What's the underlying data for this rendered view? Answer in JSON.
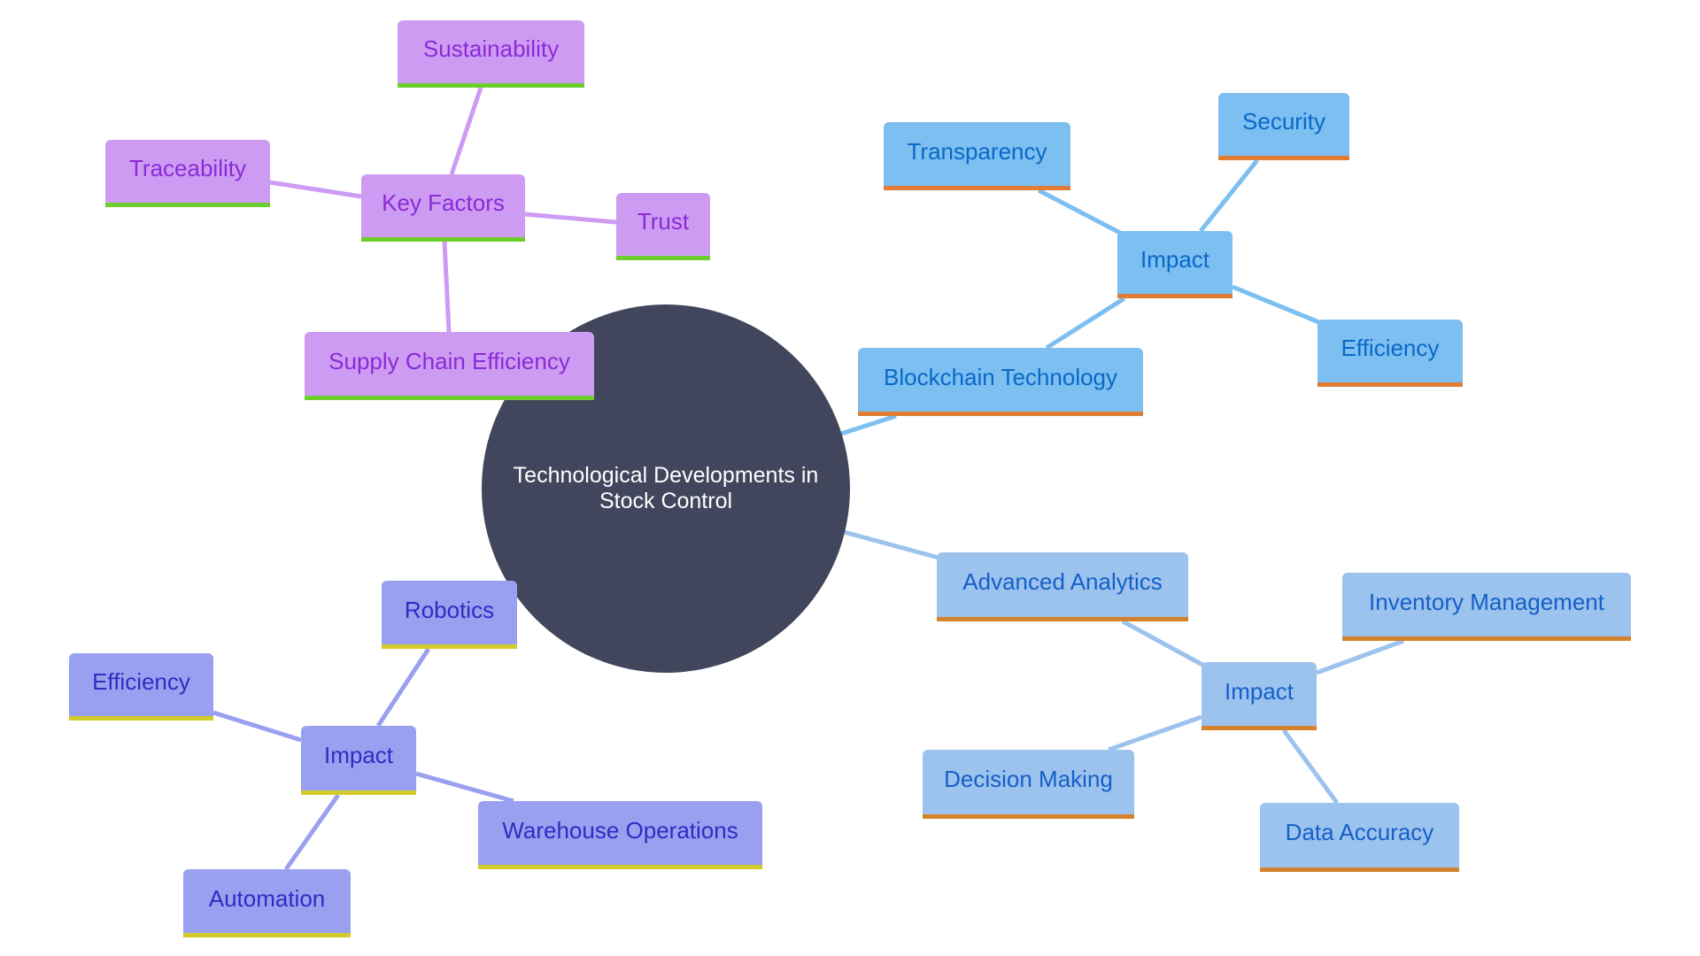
{
  "root": {
    "label": "Technological Developments in Stock Control",
    "color": "#41465c"
  },
  "branches": [
    {
      "name": "supply-chain",
      "color": "#cd9cf2",
      "accent": "#6ccd2c",
      "nodes": {
        "main": "Supply Chain Efficiency",
        "hub": "Key Factors",
        "leaves": [
          "Sustainability",
          "Traceability",
          "Trust"
        ]
      }
    },
    {
      "name": "blockchain",
      "color": "#7cbff0",
      "accent": "#e07c33",
      "nodes": {
        "main": "Blockchain Technology",
        "hub": "Impact",
        "leaves": [
          "Transparency",
          "Security",
          "Efficiency"
        ]
      }
    },
    {
      "name": "analytics",
      "color": "#9cc2ee",
      "accent": "#d4822c",
      "nodes": {
        "main": "Advanced Analytics",
        "hub": "Impact",
        "leaves": [
          "Inventory Management",
          "Decision Making",
          "Data Accuracy"
        ]
      }
    },
    {
      "name": "robotics",
      "color": "#9aa0f0",
      "accent": "#d4ca2a",
      "nodes": {
        "main": "Robotics",
        "hub": "Impact",
        "leaves": [
          "Efficiency",
          "Warehouse Operations",
          "Automation"
        ]
      }
    }
  ]
}
